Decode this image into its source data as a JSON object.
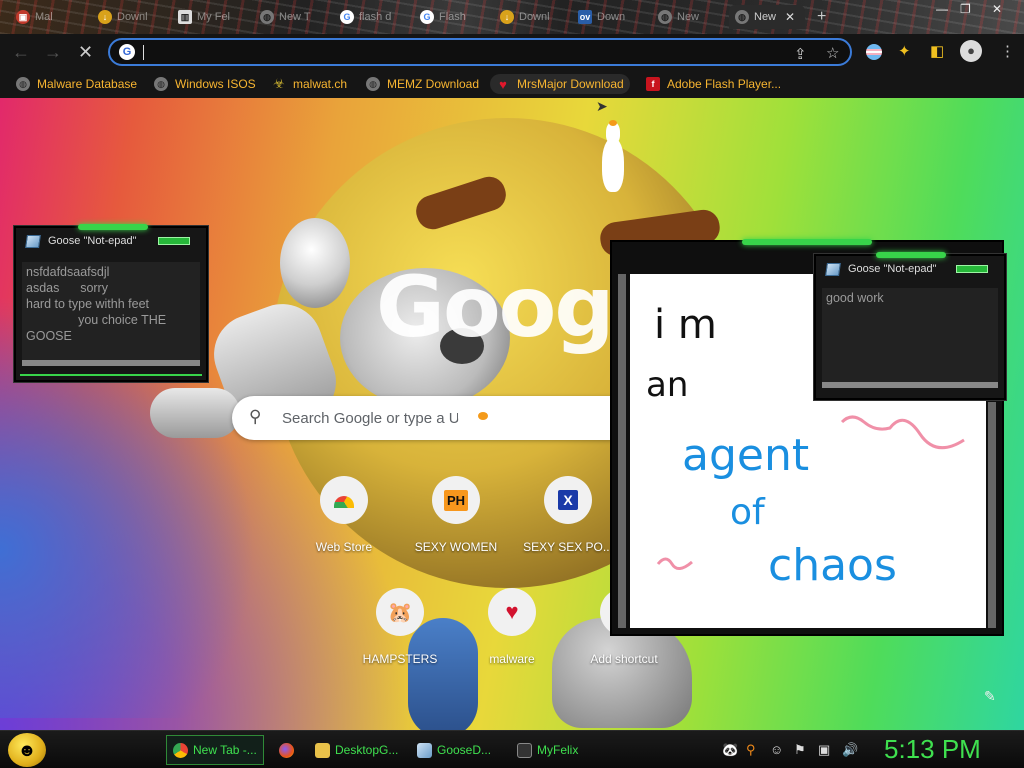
{
  "browser": {
    "tabs": [
      {
        "label": "Mal",
        "icon": "chrome-tab-favicon",
        "active": false
      },
      {
        "label": "Downl",
        "icon": "download-favicon",
        "active": false
      },
      {
        "label": "My Fel",
        "icon": "archive-favicon",
        "active": false
      },
      {
        "label": "New T",
        "icon": "globe-favicon",
        "active": false
      },
      {
        "label": "flash d",
        "icon": "google-favicon",
        "active": false
      },
      {
        "label": "Flash",
        "icon": "google-favicon",
        "active": false
      },
      {
        "label": "Downl",
        "icon": "download-favicon",
        "active": false
      },
      {
        "label": "Down",
        "icon": "ov-favicon",
        "active": false
      },
      {
        "label": "New",
        "icon": "globe-favicon",
        "active": false
      },
      {
        "label": "New",
        "icon": "globe-favicon",
        "active": true
      }
    ],
    "omnibox": {
      "value": "",
      "placeholder": ""
    },
    "bookmarks": [
      {
        "label": "Malware Database",
        "icon": "globe-icon"
      },
      {
        "label": "Windows ISOS",
        "icon": "globe-icon"
      },
      {
        "label": "malwat.ch",
        "icon": "biohazard-icon"
      },
      {
        "label": "MEMZ Download",
        "icon": "globe-icon"
      },
      {
        "label": "MrsMajor Download",
        "icon": "heart-icon"
      },
      {
        "label": "Adobe Flash Player...",
        "icon": "adobe-flash-icon"
      }
    ]
  },
  "newtab": {
    "logo_text": "Google",
    "search_placeholder": "Search Google or type a URL",
    "shortcuts_row1": [
      {
        "label": "Web Store",
        "icon": "webstore-icon",
        "glyph": ""
      },
      {
        "label": "SEXY WOMEN",
        "icon": "ph-logo-icon",
        "glyph": "PH"
      },
      {
        "label": "SEXY SEX PO...",
        "icon": "x-logo-icon",
        "glyph": "X"
      }
    ],
    "shortcuts_row2": [
      {
        "label": "HAMPSTERS",
        "icon": "hamster-icon",
        "glyph": "🐹"
      },
      {
        "label": "malware",
        "icon": "heart-icon",
        "glyph": "♥"
      },
      {
        "label": "Add shortcut",
        "icon": "plus-icon",
        "glyph": "+"
      }
    ]
  },
  "notepads": [
    {
      "title": "Goose \"Not-epad\"",
      "text": "nsfdafdsaafsdjl\nasdas      sorry\nhard to type withh feet\n               you choice THE\nGOOSE"
    },
    {
      "title": "Goose \"Not-epad\"",
      "text": "good work"
    }
  ],
  "drawing": {
    "lines": [
      "i m",
      "an",
      "agent",
      "of",
      "chaos"
    ]
  },
  "taskbar": {
    "items": [
      {
        "label": "New Tab -...",
        "icon": "chrome-icon",
        "active": true
      },
      {
        "label": "",
        "icon": "firefox-icon",
        "active": false
      },
      {
        "label": "DesktopG...",
        "icon": "folder-icon",
        "active": false
      },
      {
        "label": "GooseD...",
        "icon": "notepad-icon",
        "active": false
      },
      {
        "label": "MyFelix",
        "icon": "cat-icon",
        "active": false
      }
    ],
    "clock": "5:13 PM"
  }
}
